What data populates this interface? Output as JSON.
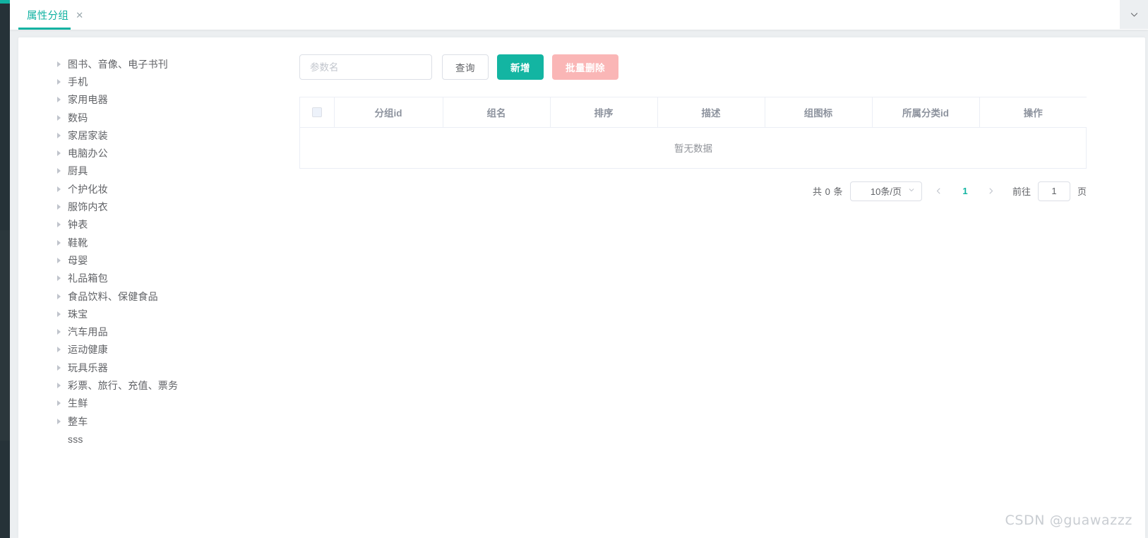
{
  "tabbar": {
    "tabs": [
      {
        "label": "属性分组",
        "close_icon": "close-icon",
        "active": true
      }
    ],
    "overflow_icon": "chevron-down-icon"
  },
  "tree": {
    "nodes": [
      {
        "label": "图书、音像、电子书刊",
        "expandable": true
      },
      {
        "label": "手机",
        "expandable": true
      },
      {
        "label": "家用电器",
        "expandable": true
      },
      {
        "label": "数码",
        "expandable": true
      },
      {
        "label": "家居家装",
        "expandable": true
      },
      {
        "label": "电脑办公",
        "expandable": true
      },
      {
        "label": "厨具",
        "expandable": true
      },
      {
        "label": "个护化妆",
        "expandable": true
      },
      {
        "label": "服饰内衣",
        "expandable": true
      },
      {
        "label": "钟表",
        "expandable": true
      },
      {
        "label": "鞋靴",
        "expandable": true
      },
      {
        "label": "母婴",
        "expandable": true
      },
      {
        "label": "礼品箱包",
        "expandable": true
      },
      {
        "label": "食品饮料、保健食品",
        "expandable": true
      },
      {
        "label": "珠宝",
        "expandable": true
      },
      {
        "label": "汽车用品",
        "expandable": true
      },
      {
        "label": "运动健康",
        "expandable": true
      },
      {
        "label": "玩具乐器",
        "expandable": true
      },
      {
        "label": "彩票、旅行、充值、票务",
        "expandable": true
      },
      {
        "label": "生鲜",
        "expandable": true
      },
      {
        "label": "整车",
        "expandable": true
      },
      {
        "label": "sss",
        "expandable": false
      }
    ],
    "arrow_icon": "chevron-right-icon"
  },
  "toolbar": {
    "search_placeholder": "参数名",
    "search_value": "",
    "query_label": "查询",
    "add_label": "新增",
    "batch_delete_label": "批量删除"
  },
  "table": {
    "columns": [
      {
        "key": "check",
        "label": ""
      },
      {
        "key": "group_id",
        "label": "分组id"
      },
      {
        "key": "group_name",
        "label": "组名"
      },
      {
        "key": "sort",
        "label": "排序"
      },
      {
        "key": "desc",
        "label": "描述"
      },
      {
        "key": "icon",
        "label": "组图标"
      },
      {
        "key": "category_id",
        "label": "所属分类id"
      },
      {
        "key": "action",
        "label": "操作"
      }
    ],
    "rows": [],
    "empty_text": "暂无数据",
    "select_all_icon": "checkbox-icon"
  },
  "pagination": {
    "total_text": "共 0 条",
    "page_size_label": "10条/页",
    "page_size_caret_icon": "chevron-down-icon",
    "prev_icon": "chevron-left-icon",
    "next_icon": "chevron-right-icon",
    "current_page": "1",
    "jump_label": "前往",
    "jump_value": "1",
    "jump_suffix": "页"
  },
  "watermark": {
    "text": "CSDN @guawazzz"
  },
  "colors": {
    "accent": "#13b5a2",
    "danger_disabled": "#fab6b6",
    "rail": "#263238",
    "page_bg": "#eceff1"
  }
}
